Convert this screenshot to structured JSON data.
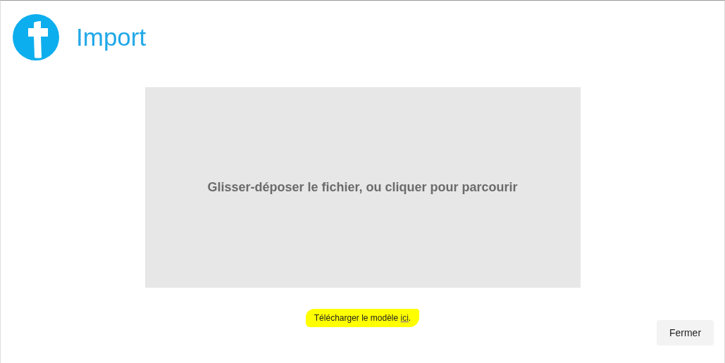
{
  "header": {
    "title": "Import"
  },
  "dropzone": {
    "label": "Glisser-déposer le fichier, ou cliquer pour parcourir"
  },
  "template_note": {
    "text": "Télécharger le modèle ",
    "link": "ici",
    "suffix": ".",
    "highlighted": true
  },
  "buttons": [
    {
      "label": "Fermer"
    }
  ]
}
